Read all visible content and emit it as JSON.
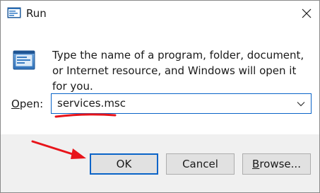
{
  "window": {
    "title": "Run",
    "icon": "run-dialog-icon",
    "close_icon": "close-icon"
  },
  "body": {
    "description": "Type the name of a program, folder, document, or Internet resource, and Windows will open it for you.",
    "open_label_accel": "O",
    "open_label_rest": "pen:",
    "open_value": "services.msc"
  },
  "buttons": {
    "ok_label": "OK",
    "cancel_label": "Cancel",
    "browse_accel": "B",
    "browse_rest": "rowse..."
  },
  "annotations": {
    "arrow_color": "#e8141a",
    "underline_color": "#e8141a"
  },
  "colors": {
    "accent": "#0a64c8",
    "footer_bg": "#f0f0f0",
    "button_bg": "#e1e1e1"
  }
}
